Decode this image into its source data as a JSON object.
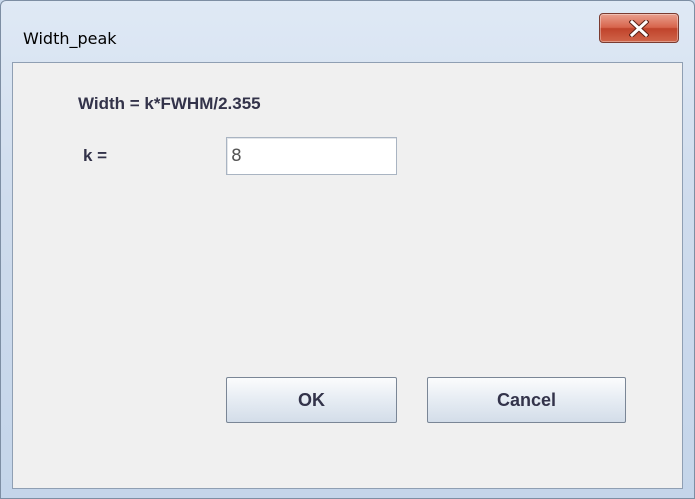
{
  "window": {
    "title": "Width_peak",
    "close_icon": "close-icon"
  },
  "form": {
    "formula": "Width = k*FWHM/2.355",
    "k_label": "k =",
    "k_value": "8"
  },
  "buttons": {
    "ok_label": "OK",
    "cancel_label": "Cancel"
  },
  "colors": {
    "close_button": "#d7644c",
    "client_background": "#f0f0f0",
    "label_text": "#33334a"
  }
}
